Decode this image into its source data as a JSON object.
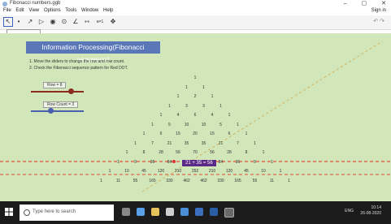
{
  "window": {
    "title": "Fibonacci numbers.ggb",
    "controls": [
      "–",
      "▢",
      "✕"
    ]
  },
  "menu": {
    "items": [
      "File",
      "Edit",
      "View",
      "Options",
      "Tools",
      "Window",
      "Help"
    ],
    "sign_in": "Sign in"
  },
  "toolbar": {
    "tools": [
      "↖",
      "•",
      "↗",
      "▷",
      "◉",
      "⊙",
      "∠",
      "⇿",
      "a=1",
      "✥"
    ]
  },
  "banner": {
    "title": "Information Processing(Fibonacci sequence)"
  },
  "instructions": [
    "1. Move the sliders to change the row and row count.",
    "2. Check the Fibonacci sequence pattern for Red DOT."
  ],
  "sliders": {
    "row": {
      "label": "Row = 8",
      "value": 8
    },
    "row_count": {
      "label": "Row Count = 3",
      "value": 3
    }
  },
  "pascal_rows": [
    [
      "1"
    ],
    [
      "1",
      "1"
    ],
    [
      "1",
      "2",
      "1"
    ],
    [
      "1",
      "3",
      "3",
      "1"
    ],
    [
      "1",
      "4",
      "6",
      "4",
      "1"
    ],
    [
      "1",
      "5",
      "10",
      "10",
      "5",
      "1"
    ],
    [
      "1",
      "6",
      "15",
      "20",
      "15",
      "6",
      "1"
    ],
    [
      "1",
      "7",
      "21",
      "35",
      "35",
      "21",
      "7",
      "1"
    ],
    [
      "1",
      "8",
      "28",
      "56",
      "70",
      "56",
      "28",
      "8",
      "1"
    ],
    [
      "1",
      "9",
      "36",
      "84",
      "126",
      "126",
      "84",
      "36",
      "9",
      "1"
    ],
    [
      "1",
      "10",
      "45",
      "120",
      "210",
      "252",
      "210",
      "120",
      "45",
      "10",
      "1"
    ],
    [
      "1",
      "11",
      "55",
      "165",
      "330",
      "462",
      "462",
      "330",
      "165",
      "55",
      "11",
      "1"
    ]
  ],
  "highlight": {
    "text": "21 + 35 = 56"
  },
  "taskbar": {
    "search_placeholder": "Type here to search",
    "time": "10:14",
    "date": "26-08-2020",
    "lang": "ENG"
  },
  "colors": {
    "banner": "#5a77b8",
    "canvas": "#d1e6b9",
    "slider_row": "#8b2a1f",
    "slider_count": "#4a5fb0",
    "red_line": "#e0503a",
    "highlight": "#5a2a86"
  }
}
